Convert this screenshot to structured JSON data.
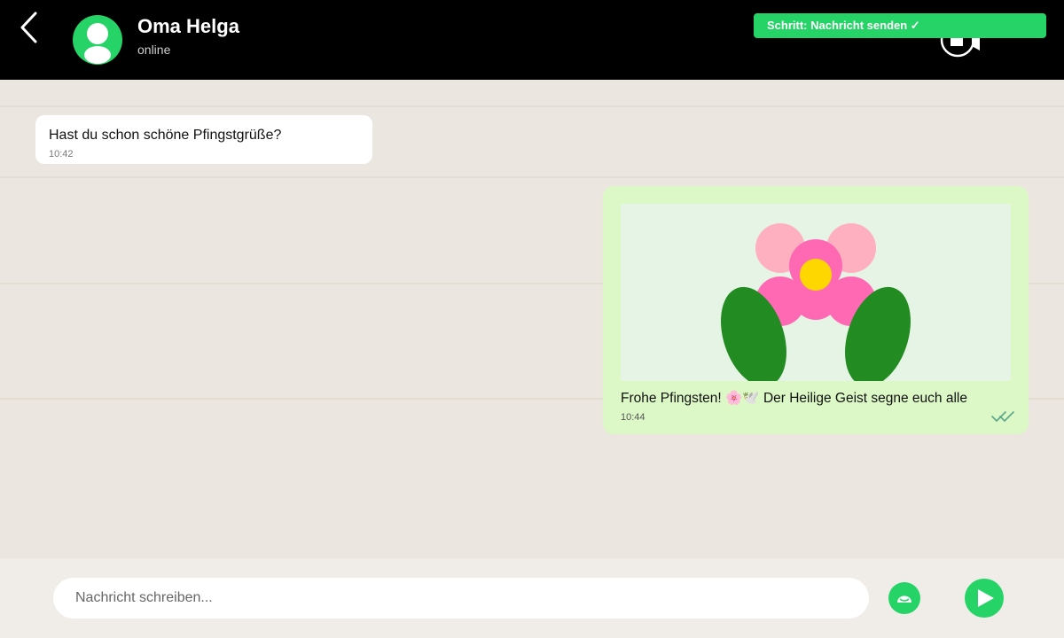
{
  "header": {
    "contact_name": "Oma Helga",
    "contact_status": "online",
    "step_badge": "Schritt: Nachricht senden ✓",
    "back_icon": "chevron-left-icon",
    "avatar_icon": "person-icon",
    "video_icon": "video-camera-icon"
  },
  "chat": {
    "incoming": {
      "text": "Hast du schon schöne Pfingstgrüße?",
      "time": "10:42"
    },
    "outgoing": {
      "image": "flower-illustration",
      "text": "Frohe Pfingsten! 🌸🕊️ Der Heilige Geist segne euch alle",
      "time": "10:44",
      "status_icon": "double-check-icon"
    }
  },
  "composer": {
    "placeholder": "Nachricht schreiben...",
    "value": "",
    "emoji_icon": "emoji-icon",
    "send_icon": "send-icon"
  },
  "colors": {
    "accent": "#25d366",
    "header_bg": "#000000",
    "chat_bg": "#ece6e0",
    "outgoing_bubble": "#dcf8c6",
    "incoming_bubble": "#ffffff"
  }
}
